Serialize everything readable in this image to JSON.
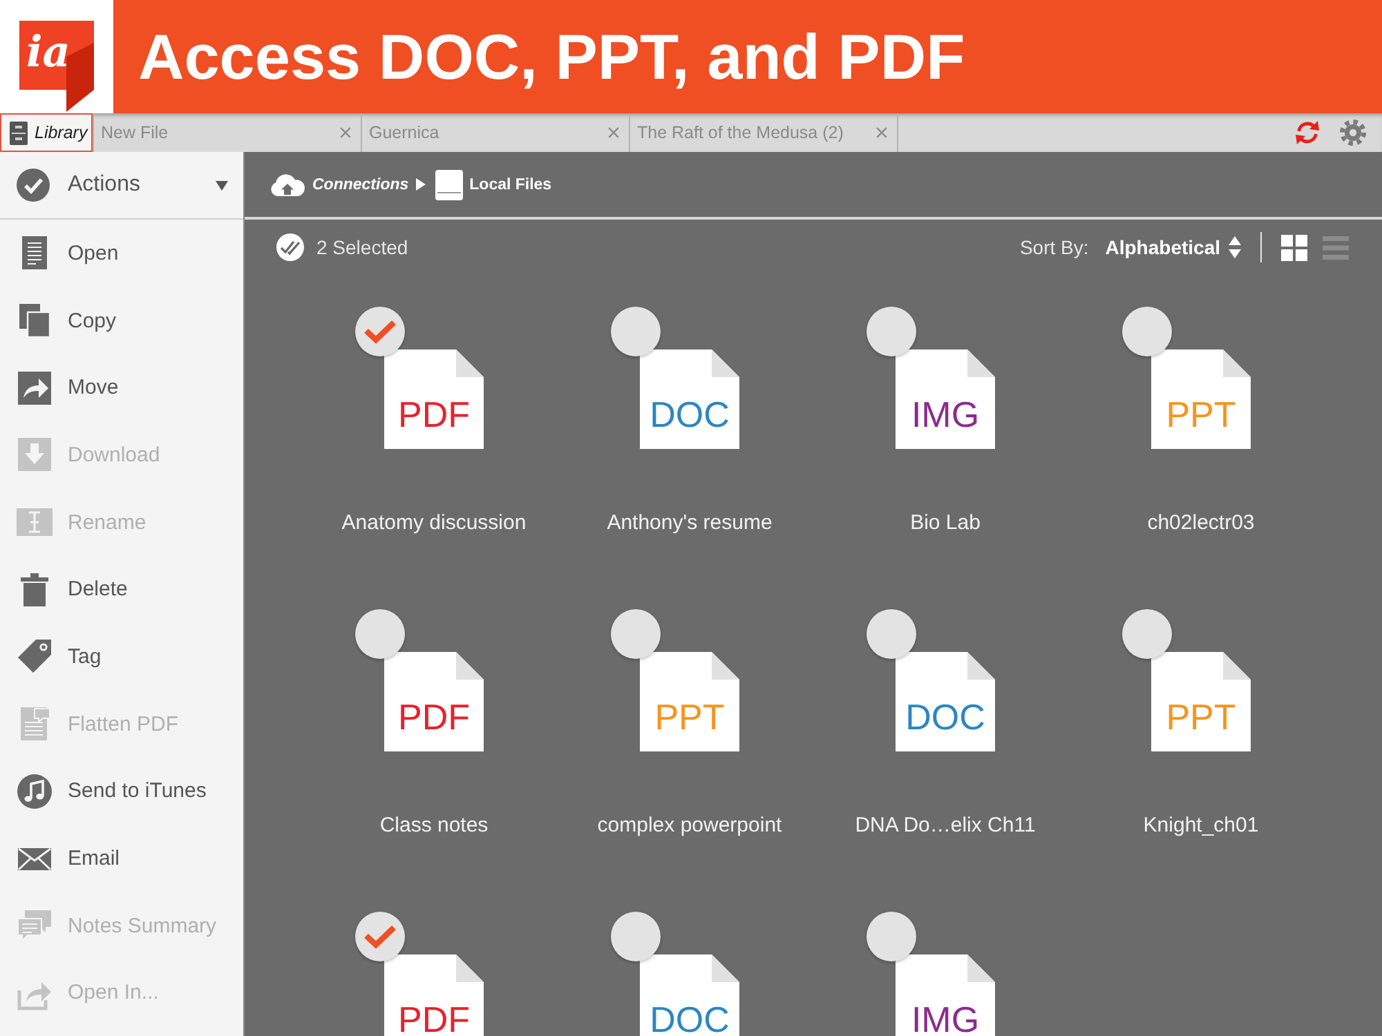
{
  "header": {
    "logo_text": "ia",
    "title": "Access DOC, PPT, and PDF"
  },
  "tabs": [
    {
      "label": "Library",
      "kind": "library",
      "selected": true
    },
    {
      "label": "New File",
      "kind": "document",
      "selected": false
    },
    {
      "label": "Guernica",
      "kind": "document",
      "selected": false
    },
    {
      "label": "The Raft of the Medusa (2)",
      "kind": "document",
      "selected": false
    }
  ],
  "actions": {
    "title": "Actions",
    "items": [
      {
        "label": "Open",
        "disabled": false
      },
      {
        "label": "Copy",
        "disabled": false
      },
      {
        "label": "Move",
        "disabled": false
      },
      {
        "label": "Download",
        "disabled": true
      },
      {
        "label": "Rename",
        "disabled": true
      },
      {
        "label": "Delete",
        "disabled": false
      },
      {
        "label": "Tag",
        "disabled": false
      },
      {
        "label": "Flatten PDF",
        "disabled": true
      },
      {
        "label": "Send to iTunes",
        "disabled": false
      },
      {
        "label": "Email",
        "disabled": false
      },
      {
        "label": "Notes Summary",
        "disabled": true
      },
      {
        "label": "Open In...",
        "disabled": true
      }
    ]
  },
  "breadcrumb": [
    {
      "label": "Connections",
      "kind": "cloud"
    },
    {
      "label": "Local Files",
      "kind": "drive"
    }
  ],
  "toolbar": {
    "selection": "2 Selected",
    "sort_label": "Sort By:",
    "sort_value": "Alphabetical",
    "views": [
      {
        "kind": "grid",
        "selected": true
      },
      {
        "kind": "list",
        "selected": false
      }
    ]
  },
  "files": [
    {
      "name": "Anatomy discussion",
      "type_label": "PDF",
      "color": "#e8212b",
      "selected": true
    },
    {
      "name": "Anthony's resume",
      "type_label": "DOC",
      "color": "#2b86c2",
      "selected": false
    },
    {
      "name": "Bio Lab",
      "type_label": "IMG",
      "color": "#8d2a8e",
      "selected": false
    },
    {
      "name": "ch02lectr03",
      "type_label": "PPT",
      "color": "#f7941d",
      "selected": false
    },
    {
      "name": "Class notes",
      "type_label": "PDF",
      "color": "#e8212b",
      "selected": false
    },
    {
      "name": "complex powerpoint",
      "type_label": "PPT",
      "color": "#f7941d",
      "selected": false
    },
    {
      "name": "DNA Do…elix Ch11",
      "type_label": "DOC",
      "color": "#2b86c2",
      "selected": false
    },
    {
      "name": "Knight_ch01",
      "type_label": "PPT",
      "color": "#f7941d",
      "selected": false
    },
    {
      "type_label": "PDF",
      "color": "#e8212b",
      "selected": true
    },
    {
      "type_label": "DOC",
      "color": "#2b86c2",
      "selected": false
    },
    {
      "type_label": "IMG",
      "color": "#8d2a8e",
      "selected": false
    }
  ]
}
